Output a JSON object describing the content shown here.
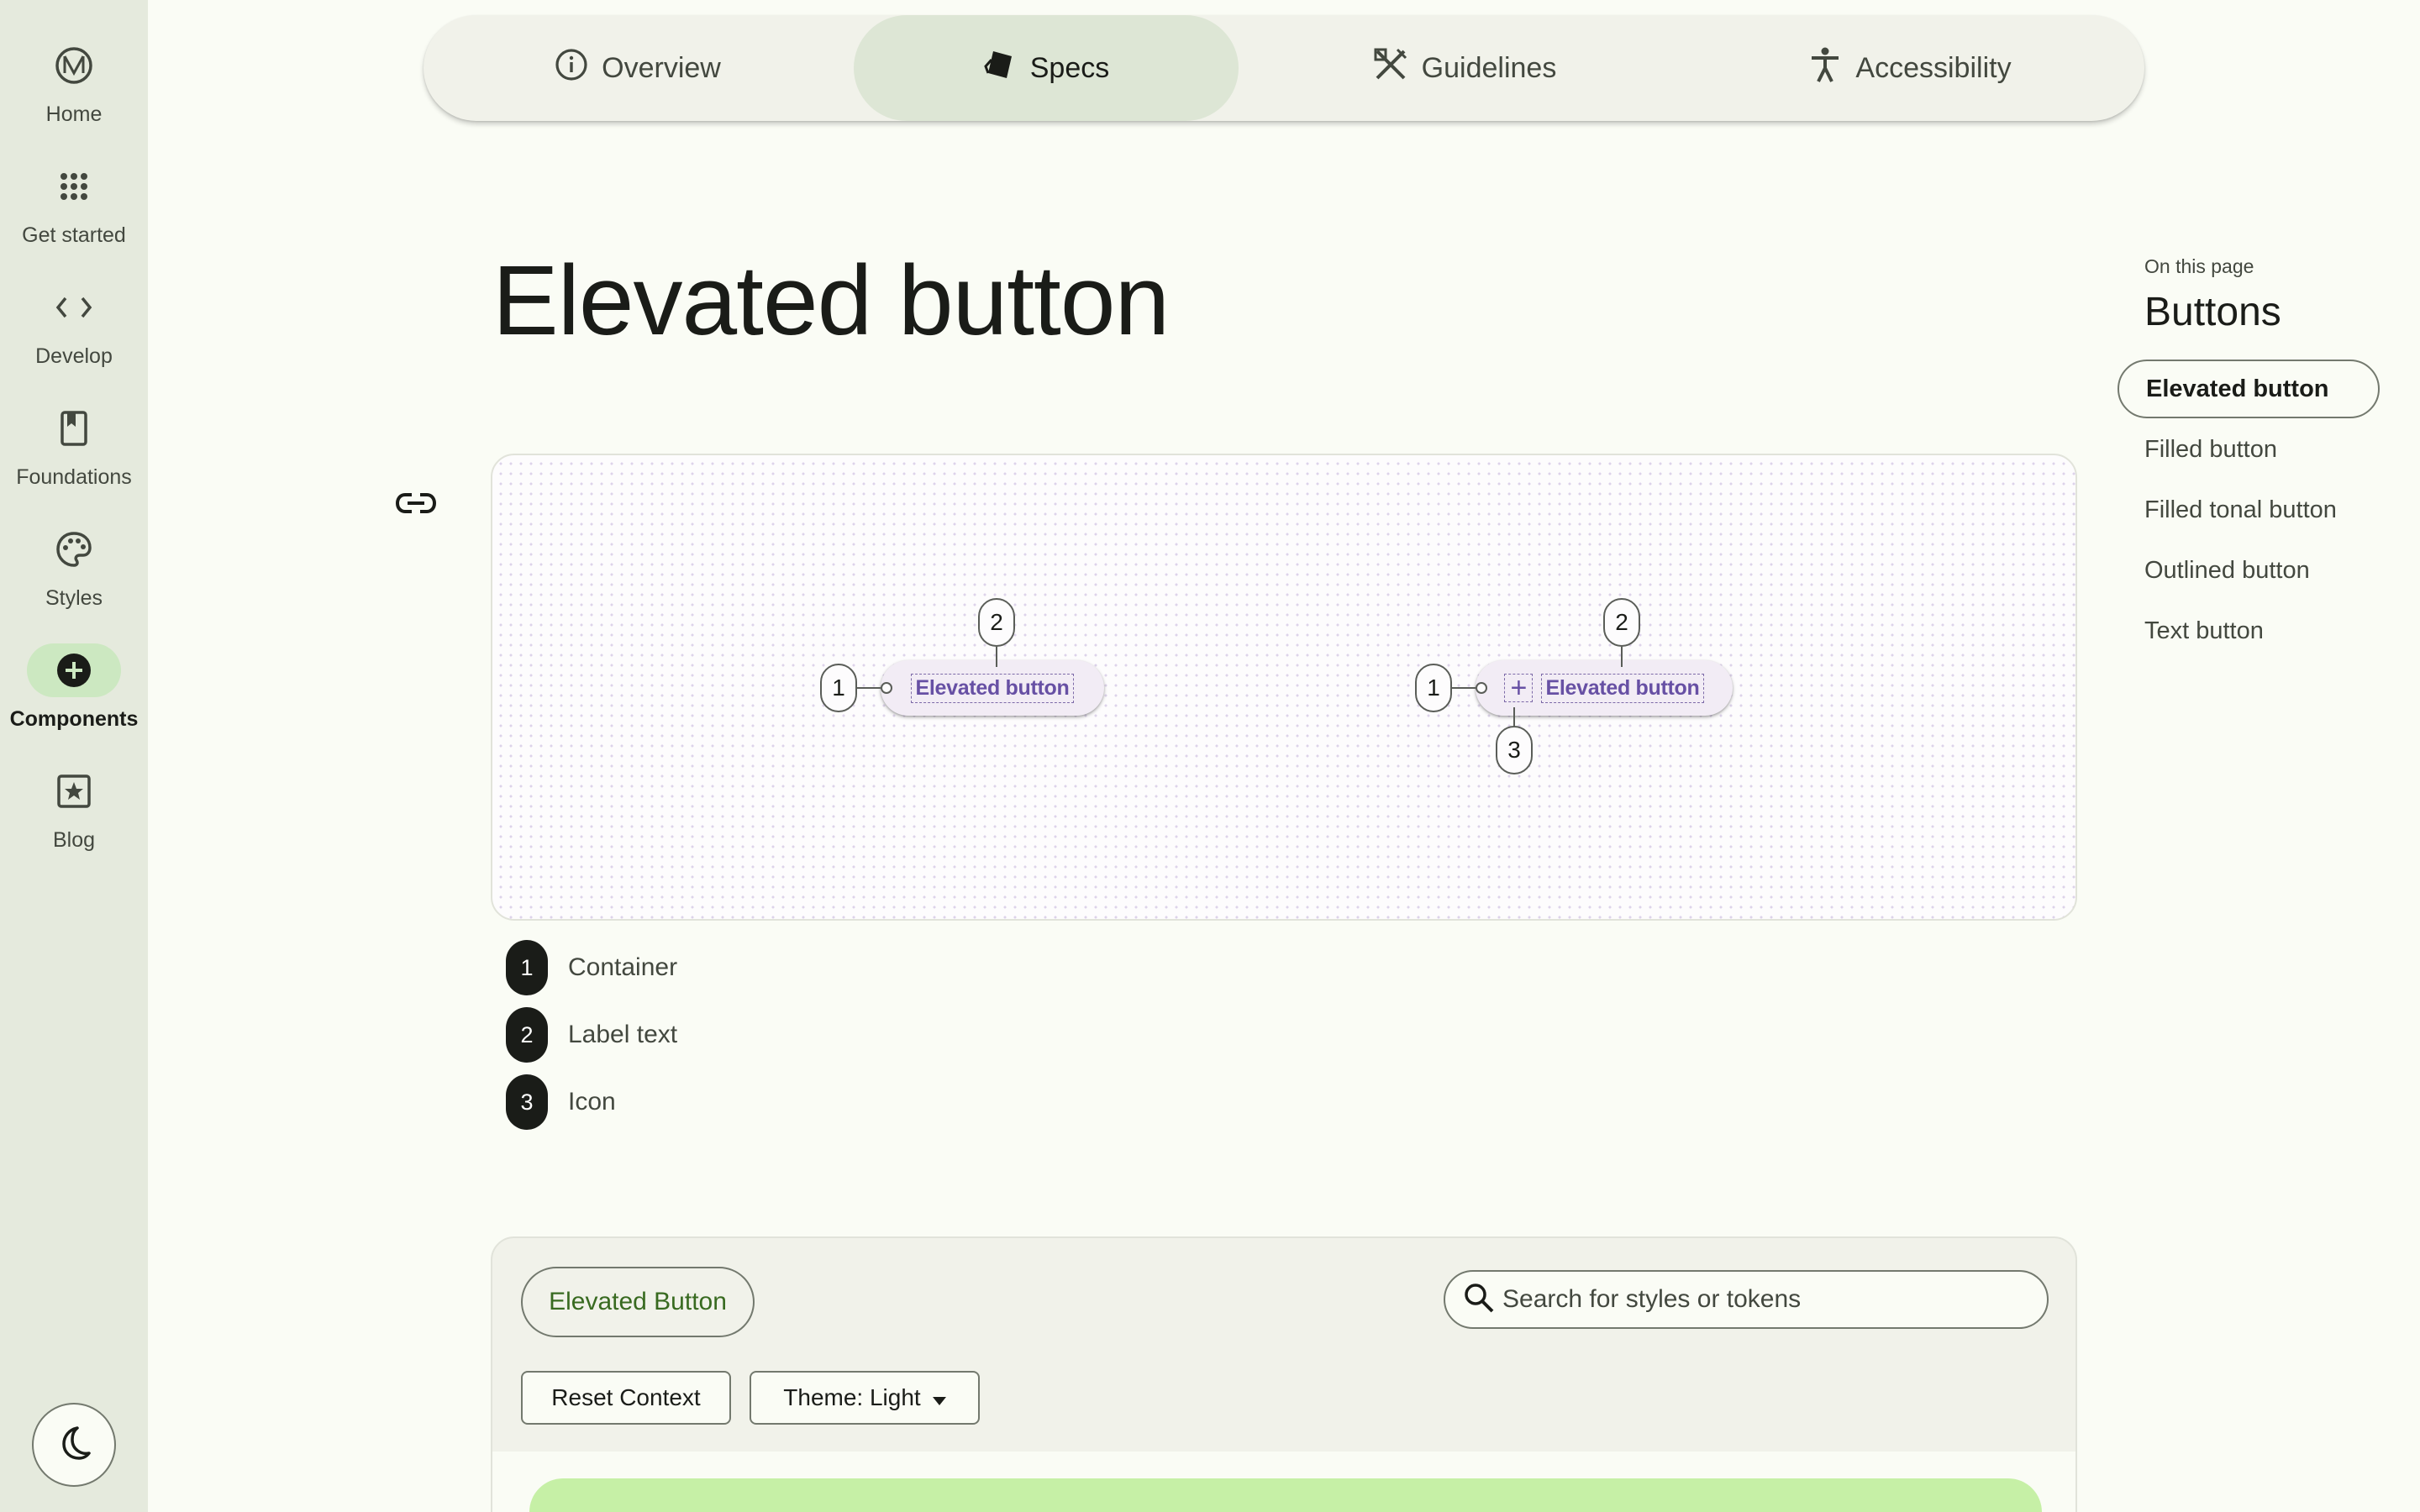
{
  "rail": {
    "items": [
      {
        "label": "Home",
        "icon": "material-logo-icon",
        "active": false
      },
      {
        "label": "Get started",
        "icon": "apps-grid-icon",
        "active": false
      },
      {
        "label": "Develop",
        "icon": "code-icon",
        "active": false
      },
      {
        "label": "Foundations",
        "icon": "book-icon",
        "active": false
      },
      {
        "label": "Styles",
        "icon": "palette-icon",
        "active": false
      },
      {
        "label": "Components",
        "icon": "add-circle-icon",
        "active": true
      },
      {
        "label": "Blog",
        "icon": "star-box-icon",
        "active": false
      }
    ],
    "theme_toggle_icon": "dark-mode-moon-icon"
  },
  "tabs": [
    {
      "label": "Overview",
      "icon": "info-icon",
      "active": false
    },
    {
      "label": "Specs",
      "icon": "specs-tag-icon",
      "active": true
    },
    {
      "label": "Guidelines",
      "icon": "design-tools-icon",
      "active": false
    },
    {
      "label": "Accessibility",
      "icon": "accessibility-icon",
      "active": false
    }
  ],
  "page": {
    "title": "Elevated button"
  },
  "diagram": {
    "button_a": {
      "label": "Elevated button",
      "markers": [
        "1",
        "2"
      ]
    },
    "button_b": {
      "label": "Elevated button",
      "markers": [
        "1",
        "2",
        "3"
      ]
    }
  },
  "legend": [
    {
      "num": "1",
      "text": "Container"
    },
    {
      "num": "2",
      "text": "Label text"
    },
    {
      "num": "3",
      "text": "Icon"
    }
  ],
  "toc": {
    "heading": "On this page",
    "title": "Buttons",
    "items": [
      {
        "label": "Elevated button",
        "active": true
      },
      {
        "label": "Filled button",
        "active": false
      },
      {
        "label": "Filled tonal button",
        "active": false
      },
      {
        "label": "Outlined button",
        "active": false
      },
      {
        "label": "Text button",
        "active": false
      }
    ]
  },
  "token_panel": {
    "chip_label": "Elevated Button",
    "search_placeholder": "Search for styles or tokens",
    "reset_label": "Reset Context",
    "theme_label": "Theme: Light"
  },
  "colors": {
    "rail_bg": "#e5eadd",
    "active_indicator": "#cce8c1",
    "page_bg": "#fafcf5",
    "demo_label": "#6750a4",
    "preview_bar": "#c6f0a6",
    "chip_text": "#386a20"
  }
}
